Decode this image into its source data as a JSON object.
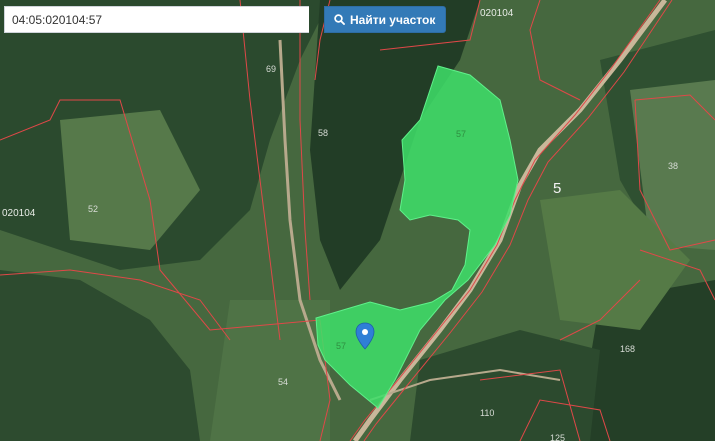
{
  "search": {
    "value": "04:05:020104:57",
    "button_label": "Найти участок",
    "button_icon": "search-icon"
  },
  "map": {
    "quarter_labels": [
      "020104",
      "020104"
    ],
    "parcel_labels": [
      "69",
      "58",
      "57",
      "52",
      "38",
      "5",
      "57",
      "54",
      "168",
      "110",
      "125"
    ],
    "selected_parcel": "57",
    "colors": {
      "selected_fill": "#3ee06a",
      "parcel_border": "#e04848",
      "road": "#c9b79a"
    },
    "marker_icon": "map-pin-icon"
  }
}
